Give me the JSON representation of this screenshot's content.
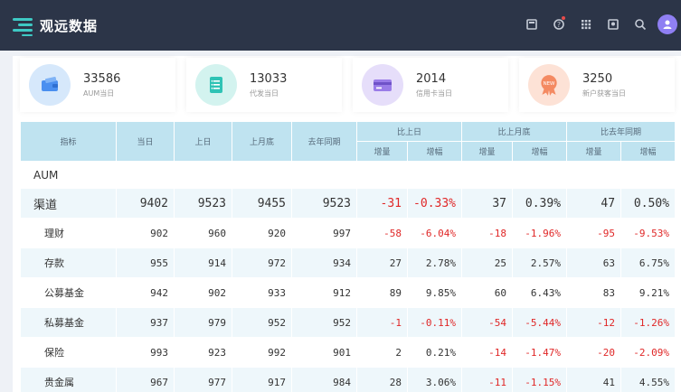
{
  "app": {
    "title": "观远数据"
  },
  "header_icons": [
    "book-icon",
    "help-icon",
    "grid-icon",
    "report-icon",
    "search-icon",
    "avatar-icon"
  ],
  "colors": {
    "topbar": "#2c3548",
    "accent": "#3ec9c4",
    "table_header": "#bfe3f0",
    "negative": "#e02727"
  },
  "cards": [
    {
      "value": "33586",
      "label": "AUM当日",
      "icon": "wallet-icon",
      "icon_bg": "#d6e8fb",
      "icon_color": "#4a8ff0"
    },
    {
      "value": "13033",
      "label": "代发当日",
      "icon": "list-icon",
      "icon_bg": "#d3f3ef",
      "icon_color": "#2fc3b5"
    },
    {
      "value": "2014",
      "label": "信用卡当日",
      "icon": "credit-card-icon",
      "icon_bg": "#e6defa",
      "icon_color": "#9a7ce8"
    },
    {
      "value": "3250",
      "label": "新户获客当日",
      "icon": "new-badge-icon",
      "icon_bg": "#fde2d6",
      "icon_color": "#f48a62"
    }
  ],
  "table": {
    "headers": {
      "metric": "指标",
      "today": "当日",
      "yesterday": "上日",
      "last_month_end": "上月底",
      "last_year_same": "去年同期",
      "vs_yesterday": "比上日",
      "vs_last_month": "比上月底",
      "vs_last_year": "比去年同期",
      "increase": "增量",
      "rate": "增幅"
    },
    "group_label": "AUM",
    "rows": [
      {
        "label": "渠道",
        "main": true,
        "values": [
          "9402",
          "9523",
          "9455",
          "9523",
          "-31",
          "-0.33%",
          "37",
          "0.39%",
          "47",
          "0.50%"
        ],
        "neg": [
          false,
          false,
          false,
          false,
          true,
          true,
          false,
          false,
          false,
          false
        ]
      },
      {
        "label": "理财",
        "main": false,
        "values": [
          "902",
          "960",
          "920",
          "997",
          "-58",
          "-6.04%",
          "-18",
          "-1.96%",
          "-95",
          "-9.53%"
        ],
        "neg": [
          false,
          false,
          false,
          false,
          true,
          true,
          true,
          true,
          true,
          true
        ]
      },
      {
        "label": "存款",
        "main": false,
        "values": [
          "955",
          "914",
          "972",
          "934",
          "27",
          "2.78%",
          "25",
          "2.57%",
          "63",
          "6.75%"
        ],
        "neg": [
          false,
          false,
          false,
          false,
          false,
          false,
          false,
          false,
          false,
          false
        ]
      },
      {
        "label": "公募基金",
        "main": false,
        "values": [
          "942",
          "902",
          "933",
          "912",
          "89",
          "9.85%",
          "60",
          "6.43%",
          "83",
          "9.21%"
        ],
        "neg": [
          false,
          false,
          false,
          false,
          false,
          false,
          false,
          false,
          false,
          false
        ]
      },
      {
        "label": "私募基金",
        "main": false,
        "values": [
          "937",
          "979",
          "952",
          "952",
          "-1",
          "-0.11%",
          "-54",
          "-5.44%",
          "-12",
          "-1.26%"
        ],
        "neg": [
          false,
          false,
          false,
          false,
          true,
          true,
          true,
          true,
          true,
          true
        ]
      },
      {
        "label": "保险",
        "main": false,
        "values": [
          "993",
          "923",
          "992",
          "901",
          "2",
          "0.21%",
          "-14",
          "-1.47%",
          "-20",
          "-2.09%"
        ],
        "neg": [
          false,
          false,
          false,
          false,
          false,
          false,
          true,
          true,
          true,
          true
        ]
      },
      {
        "label": "贵金属",
        "main": false,
        "values": [
          "967",
          "977",
          "917",
          "984",
          "28",
          "3.06%",
          "-11",
          "-1.15%",
          "41",
          "4.55%"
        ],
        "neg": [
          false,
          false,
          false,
          false,
          false,
          false,
          true,
          true,
          false,
          false
        ]
      }
    ]
  }
}
